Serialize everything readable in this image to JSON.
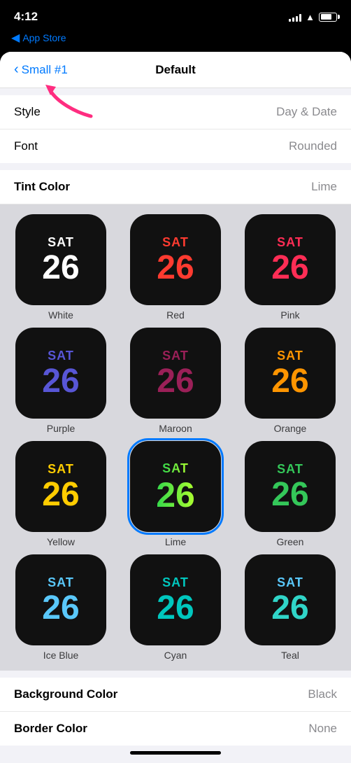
{
  "statusBar": {
    "time": "4:12",
    "appStore": "App Store"
  },
  "nav": {
    "backLabel": "Small #1",
    "title": "Default"
  },
  "settings": {
    "style": {
      "label": "Style",
      "value": "Day & Date"
    },
    "font": {
      "label": "Font",
      "value": "Rounded"
    },
    "tintColor": {
      "label": "Tint Color",
      "value": "Lime"
    },
    "backgroundColor": {
      "label": "Background Color",
      "value": "Black"
    },
    "borderColor": {
      "label": "Border Color",
      "value": "None"
    }
  },
  "colors": [
    {
      "id": "white",
      "name": "White",
      "dayColor": "#ffffff",
      "dateColor": "#ffffff",
      "selected": false
    },
    {
      "id": "red",
      "name": "Red",
      "dayColor": "#ff3b30",
      "dateColor": "#ff3b30",
      "selected": false
    },
    {
      "id": "pink",
      "name": "Pink",
      "dayColor": "#ff2d55",
      "dateColor": "#ff2d55",
      "selected": false
    },
    {
      "id": "purple",
      "name": "Purple",
      "dayColor": "#5856d6",
      "dateColor": "#5856d6",
      "selected": false
    },
    {
      "id": "maroon",
      "name": "Maroon",
      "dayColor": "#9b2058",
      "dateColor": "#9b2058",
      "selected": false
    },
    {
      "id": "orange",
      "name": "Orange",
      "dayColor": "#ff9500",
      "dateColor": "#ff9500",
      "selected": false
    },
    {
      "id": "yellow",
      "name": "Yellow",
      "dayColor": "#ffcc00",
      "dateColor": "#ffcc00",
      "selected": false
    },
    {
      "id": "lime",
      "name": "Lime",
      "dayColor": "#32d74b",
      "dateColor": "#32d74b",
      "selected": true
    },
    {
      "id": "green",
      "name": "Green",
      "dayColor": "#34c759",
      "dateColor": "#34c759",
      "selected": false
    },
    {
      "id": "cyan1",
      "name": "",
      "dayColor": "#5ac8fa",
      "dateColor": "#5ac8fa",
      "selected": false
    },
    {
      "id": "cyan2",
      "name": "",
      "dayColor": "#00c7be",
      "dateColor": "#00c7be",
      "selected": false
    },
    {
      "id": "teal",
      "name": "",
      "dayColor": "#30d5c8",
      "dateColor": "#30d5c8",
      "selected": false
    }
  ],
  "dayText": "SAT",
  "dateText": "26"
}
